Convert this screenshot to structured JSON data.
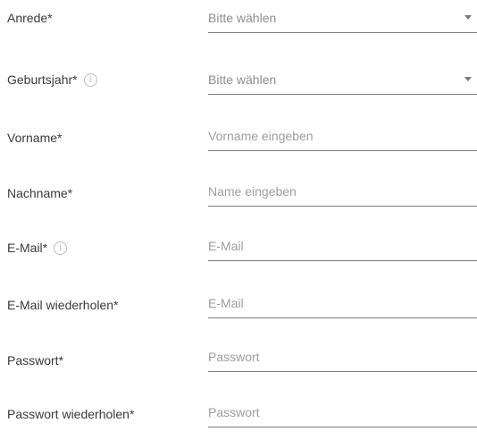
{
  "form": {
    "salutation": {
      "label": "Anrede*",
      "value": "Bitte wählen"
    },
    "birth_year": {
      "label": "Geburtsjahr*",
      "info": "i",
      "value": "Bitte wählen"
    },
    "first_name": {
      "label": "Vorname*",
      "placeholder": "Vorname eingeben"
    },
    "last_name": {
      "label": "Nachname*",
      "placeholder": "Name eingeben"
    },
    "email": {
      "label": "E-Mail*",
      "info": "i",
      "placeholder": "E-Mail"
    },
    "email_repeat": {
      "label": "E-Mail wiederholen*",
      "placeholder": "E-Mail"
    },
    "password": {
      "label": "Passwort*",
      "placeholder": "Passwort"
    },
    "password_repeat": {
      "label": "Passwort wiederholen*",
      "placeholder": "Passwort"
    }
  }
}
